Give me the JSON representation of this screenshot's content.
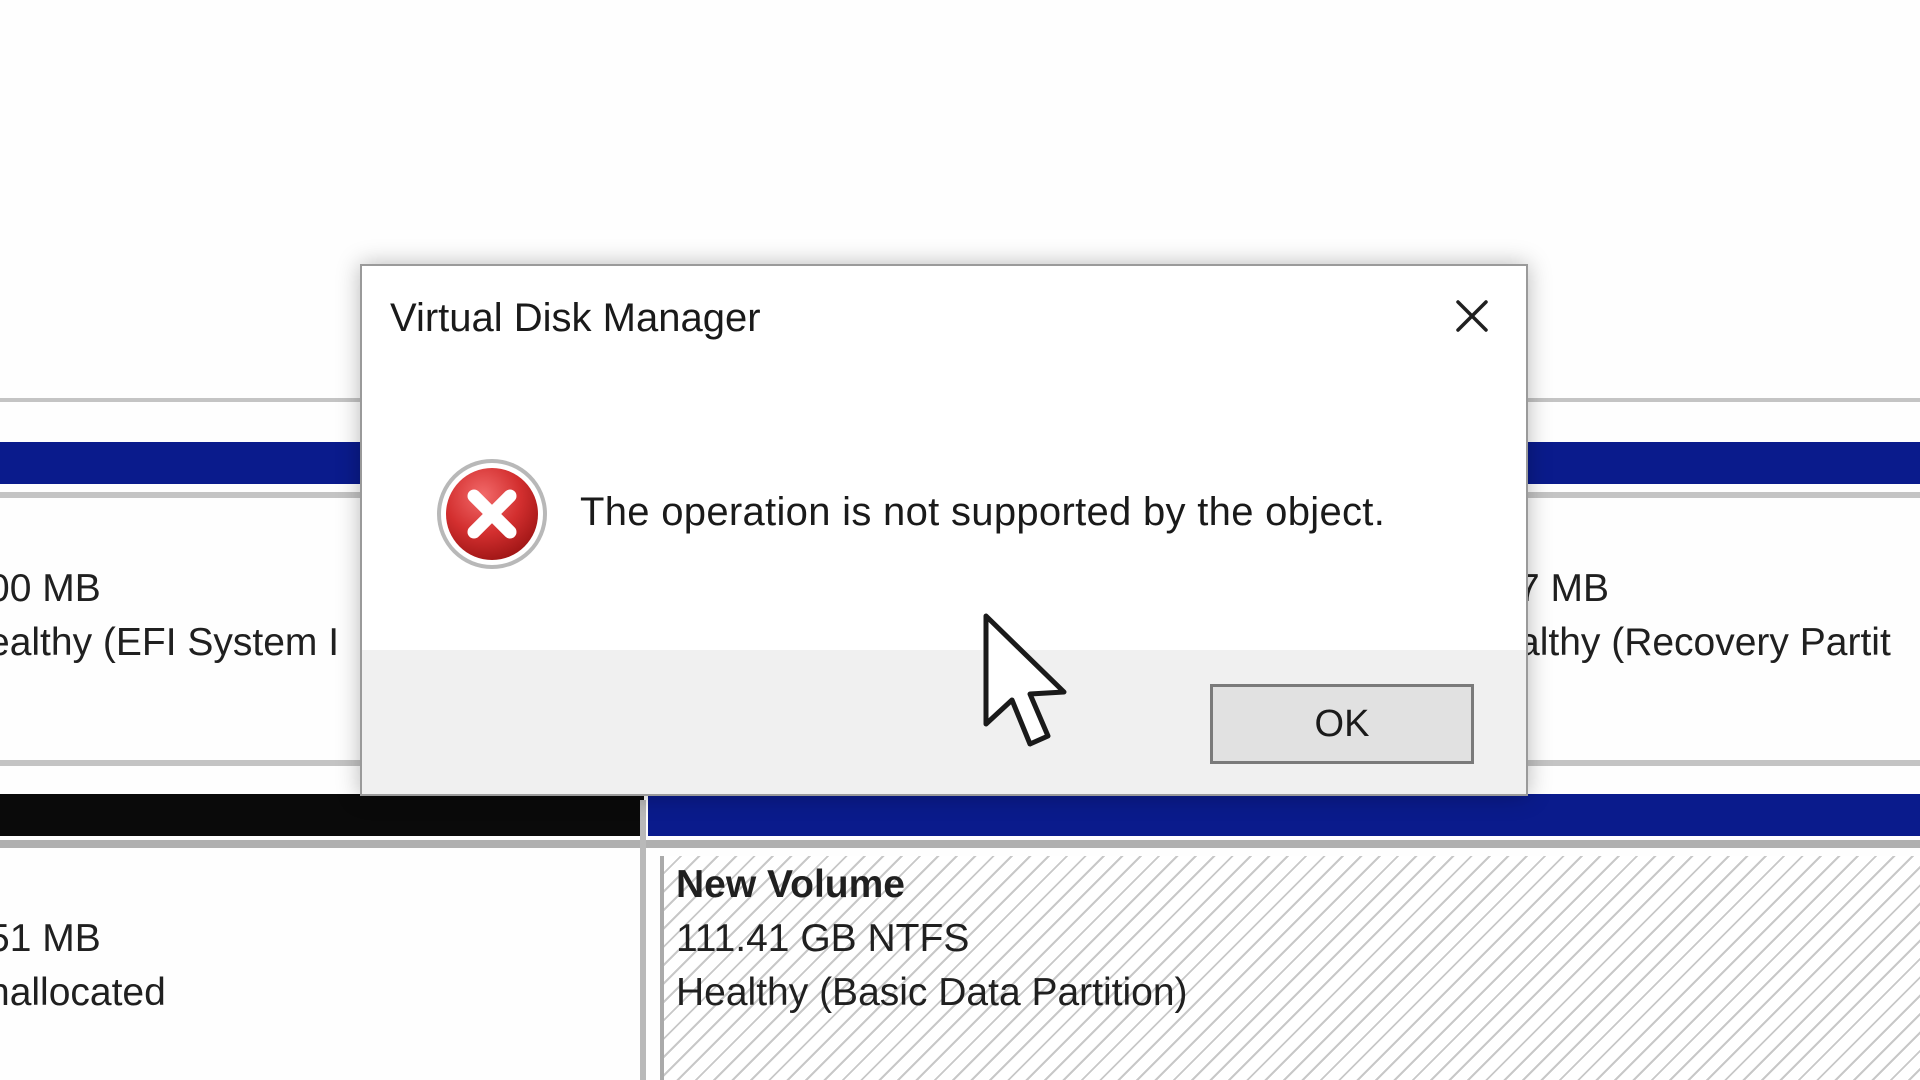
{
  "dialog": {
    "title": "Virtual Disk Manager",
    "message": "The operation is not supported by the object.",
    "ok_label": "OK",
    "icon": "error-icon",
    "close_icon": "close-icon"
  },
  "disk_map": {
    "top_row": [
      {
        "size": "00 MB",
        "status": "ealthy (EFI System I"
      },
      {
        "size": "7 MB",
        "status": "althy (Recovery Partit"
      }
    ],
    "bottom_row": [
      {
        "size": "51 MB",
        "status": "nallocated"
      },
      {
        "name": "New Volume",
        "size": "111.41 GB NTFS",
        "status": "Healthy (Basic Data Partition)"
      }
    ]
  },
  "colors": {
    "partition_bar_primary": "#0a1b8c",
    "partition_bar_unallocated": "#0a0a0a",
    "dialog_footer": "#f0f0f0",
    "error_red": "#d32f2f"
  }
}
